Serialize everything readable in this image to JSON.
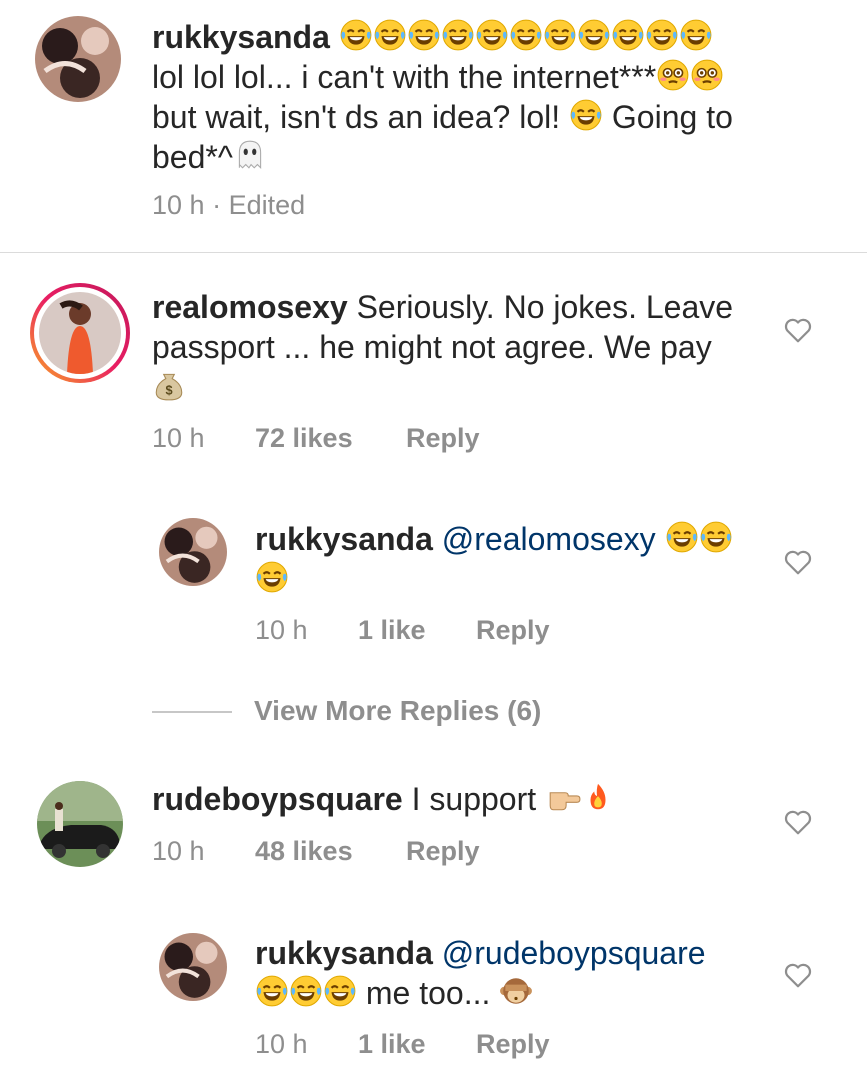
{
  "comments": [
    {
      "username": "rukkysanda",
      "line1_after": "lol lol lol... i can't with the internet***",
      "line2": "but wait, isn't ds an idea? lol!",
      "line2_after": "Going to",
      "line3": "bed*^",
      "time": "10 h",
      "edited": "· Edited"
    },
    {
      "username": "realomosexy",
      "text_1": "Seriously. No jokes. Leave",
      "text_2": "passport ... he might not agree. We pay",
      "time": "10 h",
      "likes": "72 likes",
      "reply": "Reply"
    },
    {
      "username": "rukkysanda",
      "mention": "@realomosexy",
      "time": "10 h",
      "likes": "1 like",
      "reply": "Reply"
    },
    {
      "username": "rudeboypsquare",
      "text": "I support",
      "time": "10 h",
      "likes": "48 likes",
      "reply": "Reply"
    },
    {
      "username": "rukkysanda",
      "mention": "@rudeboypsquare",
      "text": "me too...",
      "time": "10 h",
      "likes": "1 like",
      "reply": "Reply"
    }
  ],
  "view_more": "View More Replies (6)",
  "colors": {
    "text": "#262626",
    "muted": "#8e8e8e",
    "mention": "#003569",
    "divider": "#dbdbdb"
  },
  "icons": [
    "tears-of-joy-emoji",
    "flushed-emoji",
    "ghost-emoji",
    "money-bag-emoji",
    "backhand-pointing-right-emoji",
    "fire-emoji",
    "see-no-evil-monkey-emoji",
    "heart-outline-icon"
  ]
}
